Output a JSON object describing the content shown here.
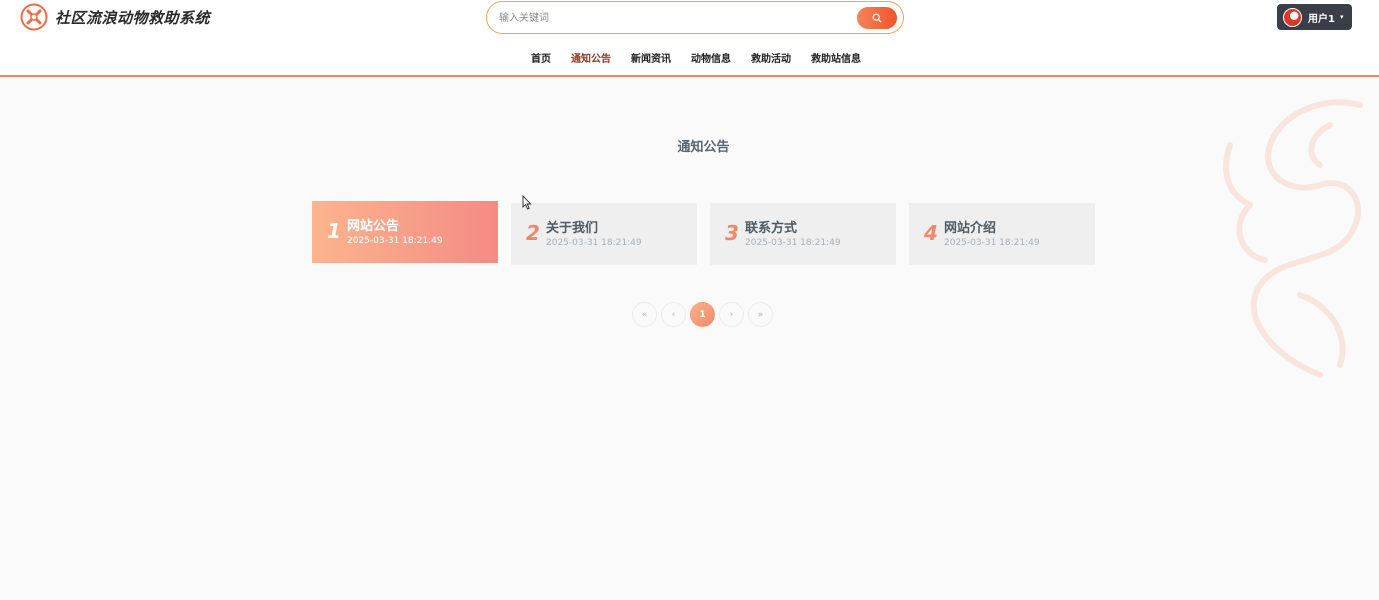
{
  "header": {
    "site_title": "社区流浪动物救助系统",
    "search_placeholder": "输入关键词",
    "user_label": "用户1",
    "caret": "▾"
  },
  "nav": {
    "items": [
      {
        "label": "首页",
        "active": false
      },
      {
        "label": "通知公告",
        "active": true
      },
      {
        "label": "新闻资讯",
        "active": false
      },
      {
        "label": "动物信息",
        "active": false
      },
      {
        "label": "救助活动",
        "active": false
      },
      {
        "label": "救助站信息",
        "active": false
      }
    ]
  },
  "main": {
    "title": "通知公告",
    "notices": [
      {
        "num": "1",
        "title": "网站公告",
        "date": "2025-03-31 18:21:49"
      },
      {
        "num": "2",
        "title": "关于我们",
        "date": "2025-03-31 18:21:49"
      },
      {
        "num": "3",
        "title": "联系方式",
        "date": "2025-03-31 18:21:49"
      },
      {
        "num": "4",
        "title": "网站介绍",
        "date": "2025-03-31 18:21:49"
      }
    ]
  },
  "pagination": {
    "first": "«",
    "prev": "‹",
    "current": "1",
    "next": "›",
    "last": "»"
  },
  "colors": {
    "accent": "#f2542d",
    "active_card_start": "#fdb48e",
    "active_card_end": "#f38b84",
    "header_border": "#f08a5d"
  }
}
